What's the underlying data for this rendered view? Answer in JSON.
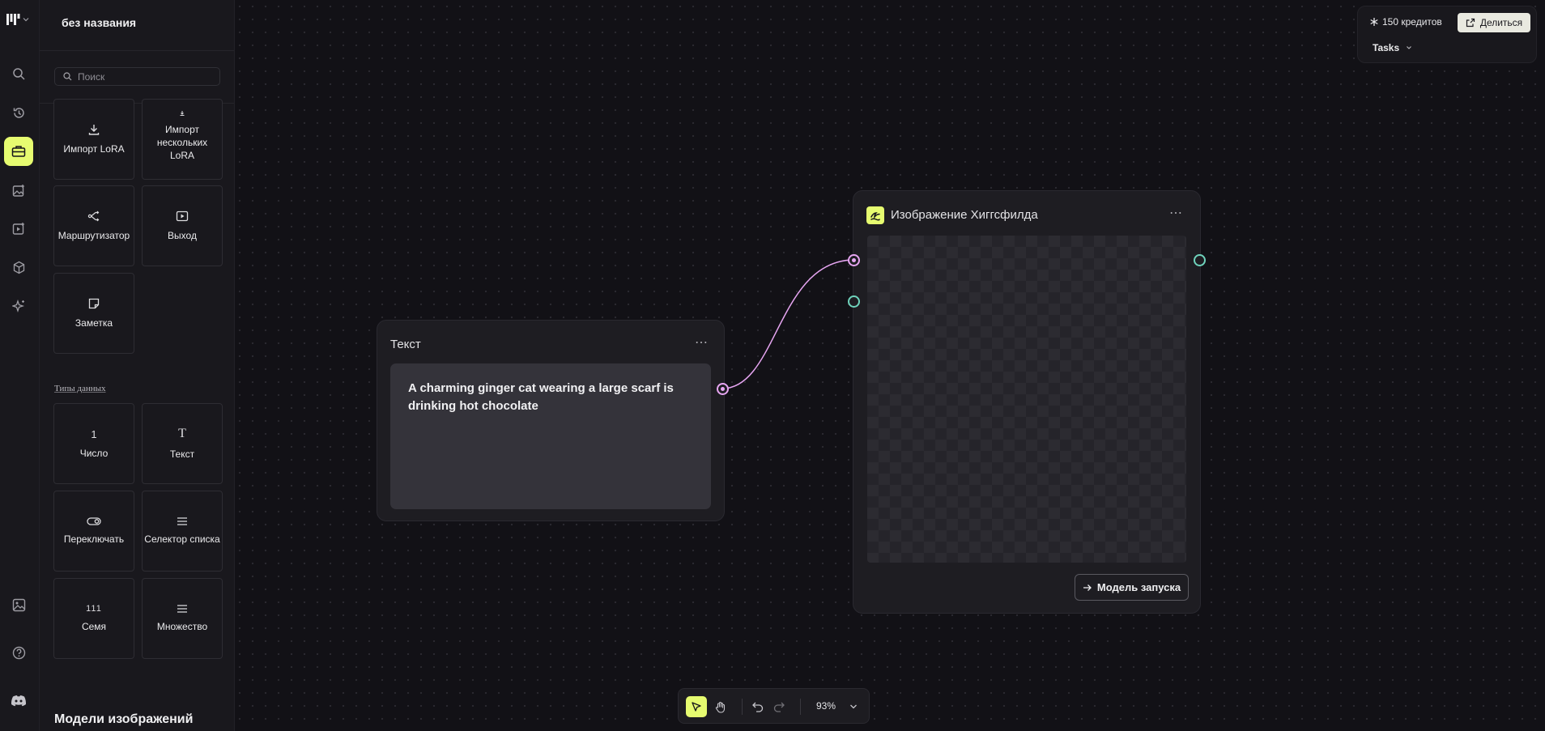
{
  "project": {
    "title": "без названия"
  },
  "rail": {
    "items": [
      {
        "name": "search-icon"
      },
      {
        "name": "history-icon"
      },
      {
        "name": "toolbox-icon",
        "active": true
      },
      {
        "name": "image-edit-icon"
      },
      {
        "name": "video-icon"
      },
      {
        "name": "cube-icon"
      },
      {
        "name": "sparkle-icon"
      },
      {
        "name": "gallery-icon"
      },
      {
        "name": "help-icon"
      },
      {
        "name": "discord-icon"
      }
    ]
  },
  "library": {
    "search_placeholder": "Поиск",
    "tiles": [
      {
        "label": "Импорт LoRA",
        "icon": "download-icon"
      },
      {
        "label": "Импорт нескольких LoRA",
        "icon": "download-small-icon"
      },
      {
        "label": "Маршрутизатор",
        "icon": "router-icon"
      },
      {
        "label": "Выход",
        "icon": "output-icon"
      },
      {
        "label": "Заметка",
        "icon": "note-icon"
      }
    ],
    "data_types_label": "Типы данных",
    "data_type_tiles": [
      {
        "label": "Число",
        "icon": "number-icon",
        "glyph": "1"
      },
      {
        "label": "Текст",
        "icon": "text-icon",
        "glyph": "T"
      },
      {
        "label": "Переключать",
        "icon": "toggle-icon"
      },
      {
        "label": "Селектор списка",
        "icon": "list-icon"
      },
      {
        "label": "Семя",
        "icon": "seed-icon",
        "glyph": "111"
      },
      {
        "label": "Множество",
        "icon": "array-icon"
      }
    ],
    "next_section_title": "Модели изображений"
  },
  "topbar": {
    "credits": "150 кредитов",
    "share_label": "Делиться",
    "tasks_label": "Tasks"
  },
  "text_node": {
    "title": "Текст",
    "content": "A charming ginger cat wearing a large scarf is drinking hot chocolate"
  },
  "image_node": {
    "title": "Изображение Хиггсфилда",
    "run_label": "Модель запуска"
  },
  "toolbar": {
    "zoom": "93%"
  },
  "colors": {
    "accent": "#e6fb70",
    "wire": "#e7a6f2",
    "port_teal": "#6fd3bc",
    "canvas": "#121116"
  }
}
